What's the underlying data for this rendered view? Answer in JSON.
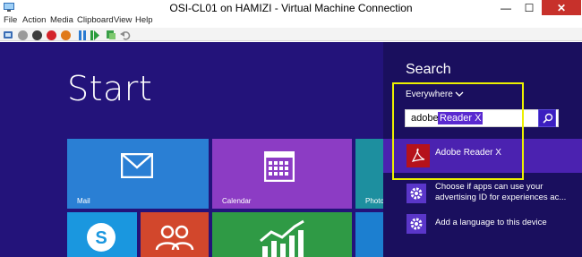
{
  "window": {
    "title": "OSI-CL01 on HAMIZI - Virtual Machine Connection",
    "min_glyph": "—",
    "max_glyph": "☐",
    "close_glyph": "✕"
  },
  "menu": {
    "items": [
      "File",
      "Action",
      "Media",
      "Clipboard",
      "View",
      "Help"
    ]
  },
  "toolbar": {
    "icons": [
      "ctrl-alt-del-icon",
      "start-icon",
      "turn-off-icon",
      "shut-down-icon",
      "save-icon",
      "pause-icon",
      "reset-icon",
      "checkpoint-icon",
      "revert-icon"
    ]
  },
  "start": {
    "title": "Start",
    "tiles": {
      "mail": "Mail",
      "calendar": "Calendar",
      "photos": "Photo"
    }
  },
  "search": {
    "title": "Search",
    "scope": "Everywhere",
    "query_typed": "adobe",
    "query_autocomplete": "Reader X",
    "result": "Adobe Reader X",
    "settings": [
      {
        "line1": "Choose if apps can use your",
        "line2": "advertising ID for experiences ac..."
      },
      {
        "line1": "Add a language to this device",
        "line2": ""
      }
    ]
  },
  "colors": {
    "start_bg": "#23137a",
    "pane_bg": "#1a0f5e",
    "selected_result": "#4b22b0",
    "highlight_box": "#ecf000",
    "pdf_red": "#b5121b"
  }
}
